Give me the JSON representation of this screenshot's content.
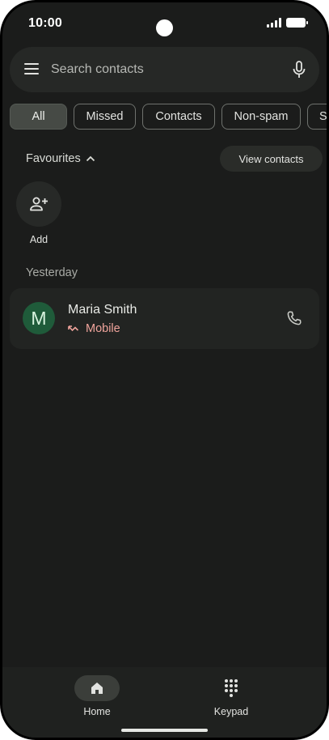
{
  "status_bar": {
    "time": "10:00"
  },
  "search": {
    "placeholder": "Search contacts"
  },
  "filters": [
    {
      "label": "All",
      "active": true
    },
    {
      "label": "Missed",
      "active": false
    },
    {
      "label": "Contacts",
      "active": false
    },
    {
      "label": "Non-spam",
      "active": false
    },
    {
      "label": "S",
      "active": false
    }
  ],
  "favourites": {
    "title": "Favourites",
    "view_contacts": "View contacts",
    "add_label": "Add"
  },
  "recents": {
    "section_label": "Yesterday",
    "calls": [
      {
        "avatar_letter": "M",
        "name": "Maria Smith",
        "type": "Mobile",
        "status": "missed"
      }
    ]
  },
  "nav": {
    "home": "Home",
    "keypad": "Keypad"
  },
  "colors": {
    "background": "#1b1c1b",
    "missed": "#f0a49c",
    "avatar": "#1f5b3a"
  }
}
